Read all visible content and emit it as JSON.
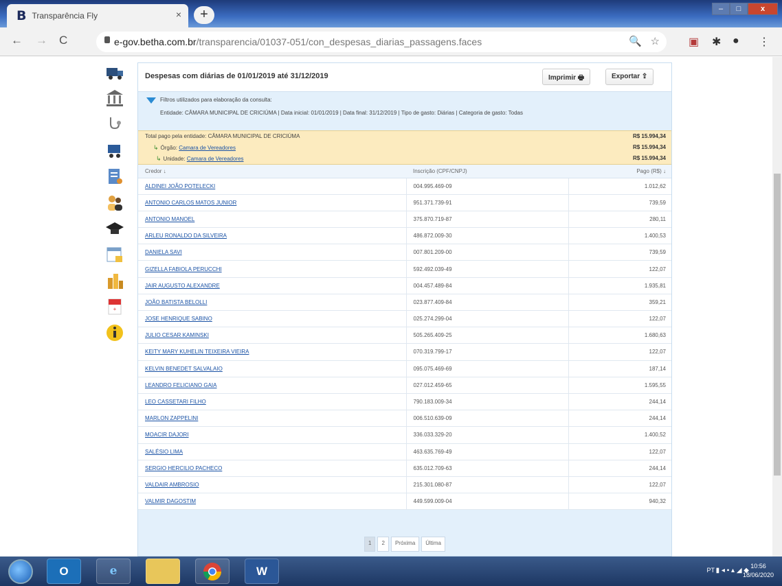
{
  "browser": {
    "tab_title": "Transparência Fly",
    "tab_favicon": "B",
    "tab_close": "×",
    "new_tab": "+",
    "url_domain": "e-gov.betha.com.br",
    "url_path": "/transparencia/01037-051/con_despesas_diarias_passagens.faces",
    "window_buttons": {
      "min": "–",
      "max": "□",
      "close": "x"
    }
  },
  "page": {
    "title": "Despesas com diárias de 01/01/2019 até 31/12/2019",
    "print_label": "Imprimir",
    "export_label": "Exportar",
    "filters_title": "Filtros utilizados para elaboração da consulta:",
    "filters_detail": "Entidade: CÂMARA MUNICIPAL DE CRICIÚMA | Data inicial: 01/01/2019 | Data final: 31/12/2019 | Tipo de gasto: Diárias | Categoria de gasto: Todas",
    "summary": {
      "entity_label": "Total pago pela entidade: CÂMARA MUNICIPAL DE CRICIÚMA",
      "entity_amount": "R$ 15.994,34",
      "organ_prefix": "Órgão:",
      "organ_name": "Camara de Vereadores",
      "organ_amount": "R$ 15.994,34",
      "unit_prefix": "Unidade:",
      "unit_name": "Camara de Vereadores",
      "unit_amount": "R$ 15.994,34"
    },
    "table": {
      "headers": {
        "creditor": "Credor ↓",
        "doc": "Inscrição (CPF/CNPJ)",
        "paid": "Pago (R$) ↓"
      },
      "rows": [
        {
          "creditor": "ALDINEI JOÃO POTELECKI",
          "doc": "004.995.469-09",
          "paid": "1.012,62"
        },
        {
          "creditor": "ANTONIO CARLOS MATOS JUNIOR",
          "doc": "951.371.739-91",
          "paid": "739,59"
        },
        {
          "creditor": "ANTONIO MANOEL",
          "doc": "375.870.719-87",
          "paid": "280,11"
        },
        {
          "creditor": "ARLEU RONALDO DA SILVEIRA",
          "doc": "486.872.009-30",
          "paid": "1.400,53"
        },
        {
          "creditor": "DANIELA SAVI",
          "doc": "007.801.209-00",
          "paid": "739,59"
        },
        {
          "creditor": "GIZELLA FABIOLA PERUCCHI",
          "doc": "592.492.039-49",
          "paid": "122,07"
        },
        {
          "creditor": "JAIR AUGUSTO ALEXANDRE",
          "doc": "004.457.489-84",
          "paid": "1.935,81"
        },
        {
          "creditor": "JOÃO BATISTA BELOLLI",
          "doc": "023.877.409-84",
          "paid": "359,21"
        },
        {
          "creditor": "JOSE HENRIQUE SABINO",
          "doc": "025.274.299-04",
          "paid": "122,07"
        },
        {
          "creditor": "JULIO CESAR KAMINSKI",
          "doc": "505.265.409-25",
          "paid": "1.680,63"
        },
        {
          "creditor": "KEITY MARY KUHELIN TEIXEIRA VIEIRA",
          "doc": "070.319.799-17",
          "paid": "122,07"
        },
        {
          "creditor": "KELVIN BENEDET SALVALAIO",
          "doc": "095.075.469-69",
          "paid": "187,14"
        },
        {
          "creditor": "LEANDRO FELICIANO GAIA",
          "doc": "027.012.459-65",
          "paid": "1.595,55"
        },
        {
          "creditor": "LEO CASSETARI FILHO",
          "doc": "790.183.009-34",
          "paid": "244,14"
        },
        {
          "creditor": "MARLON ZAPPELINI",
          "doc": "006.510.639-09",
          "paid": "244,14"
        },
        {
          "creditor": "MOACIR DAJORI",
          "doc": "336.033.329-20",
          "paid": "1.400,52"
        },
        {
          "creditor": "SALÉSIO LIMA",
          "doc": "463.635.769-49",
          "paid": "122,07"
        },
        {
          "creditor": "SERGIO HERCILIO PACHECO",
          "doc": "635.012.709-63",
          "paid": "244,14"
        },
        {
          "creditor": "VALDAIR AMBROSIO",
          "doc": "215.301.080-87",
          "paid": "122,07"
        },
        {
          "creditor": "VALMIR DAGOSTIM",
          "doc": "449.599.009-04",
          "paid": "940,32"
        }
      ]
    },
    "pager": {
      "page1": "1",
      "page2": "2",
      "next": "Próxima",
      "last": "Última"
    }
  },
  "taskbar": {
    "apps": [
      "O",
      "e",
      "",
      "",
      "W"
    ],
    "tray_text": "PT",
    "time": "10:56",
    "date": "18/06/2020"
  }
}
